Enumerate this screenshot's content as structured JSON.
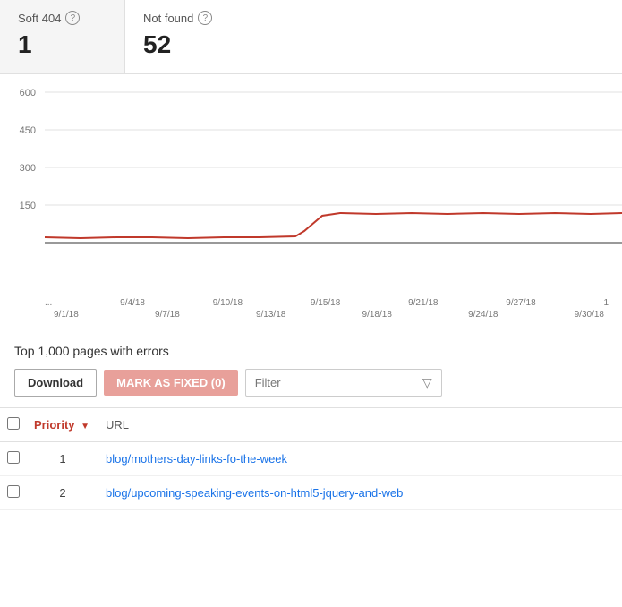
{
  "metrics": {
    "soft404": {
      "label": "Soft 404",
      "value": "1"
    },
    "notfound": {
      "label": "Not found",
      "value": "52"
    }
  },
  "chart": {
    "y_labels": [
      "600",
      "450",
      "300",
      "150"
    ],
    "x_labels_top": [
      "...",
      "9/4/18",
      "9/10/18",
      "9/15/18",
      "9/21/18",
      "9/27/18",
      "1"
    ],
    "x_labels_bottom": [
      "9/1/18",
      "9/7/18",
      "9/13/18",
      "9/18/18",
      "9/24/18",
      "9/30/18"
    ]
  },
  "section": {
    "title": "Top 1,000 pages with errors"
  },
  "toolbar": {
    "download_label": "Download",
    "mark_fixed_label": "MARK AS FIXED (0)",
    "filter_placeholder": "Filter"
  },
  "table": {
    "columns": [
      {
        "id": "checkbox",
        "label": ""
      },
      {
        "id": "priority",
        "label": "Priority"
      },
      {
        "id": "url",
        "label": "URL"
      }
    ],
    "rows": [
      {
        "priority": "1",
        "url": "blog/mothers-day-links-fo-the-week"
      },
      {
        "priority": "2",
        "url": "blog/upcoming-speaking-events-on-html5-jquery-and-web"
      }
    ]
  },
  "colors": {
    "accent_red": "#c0392b",
    "line_red": "#c0392b",
    "mark_fixed_bg": "#e8a09a",
    "grid_line": "#e0e0e0"
  }
}
